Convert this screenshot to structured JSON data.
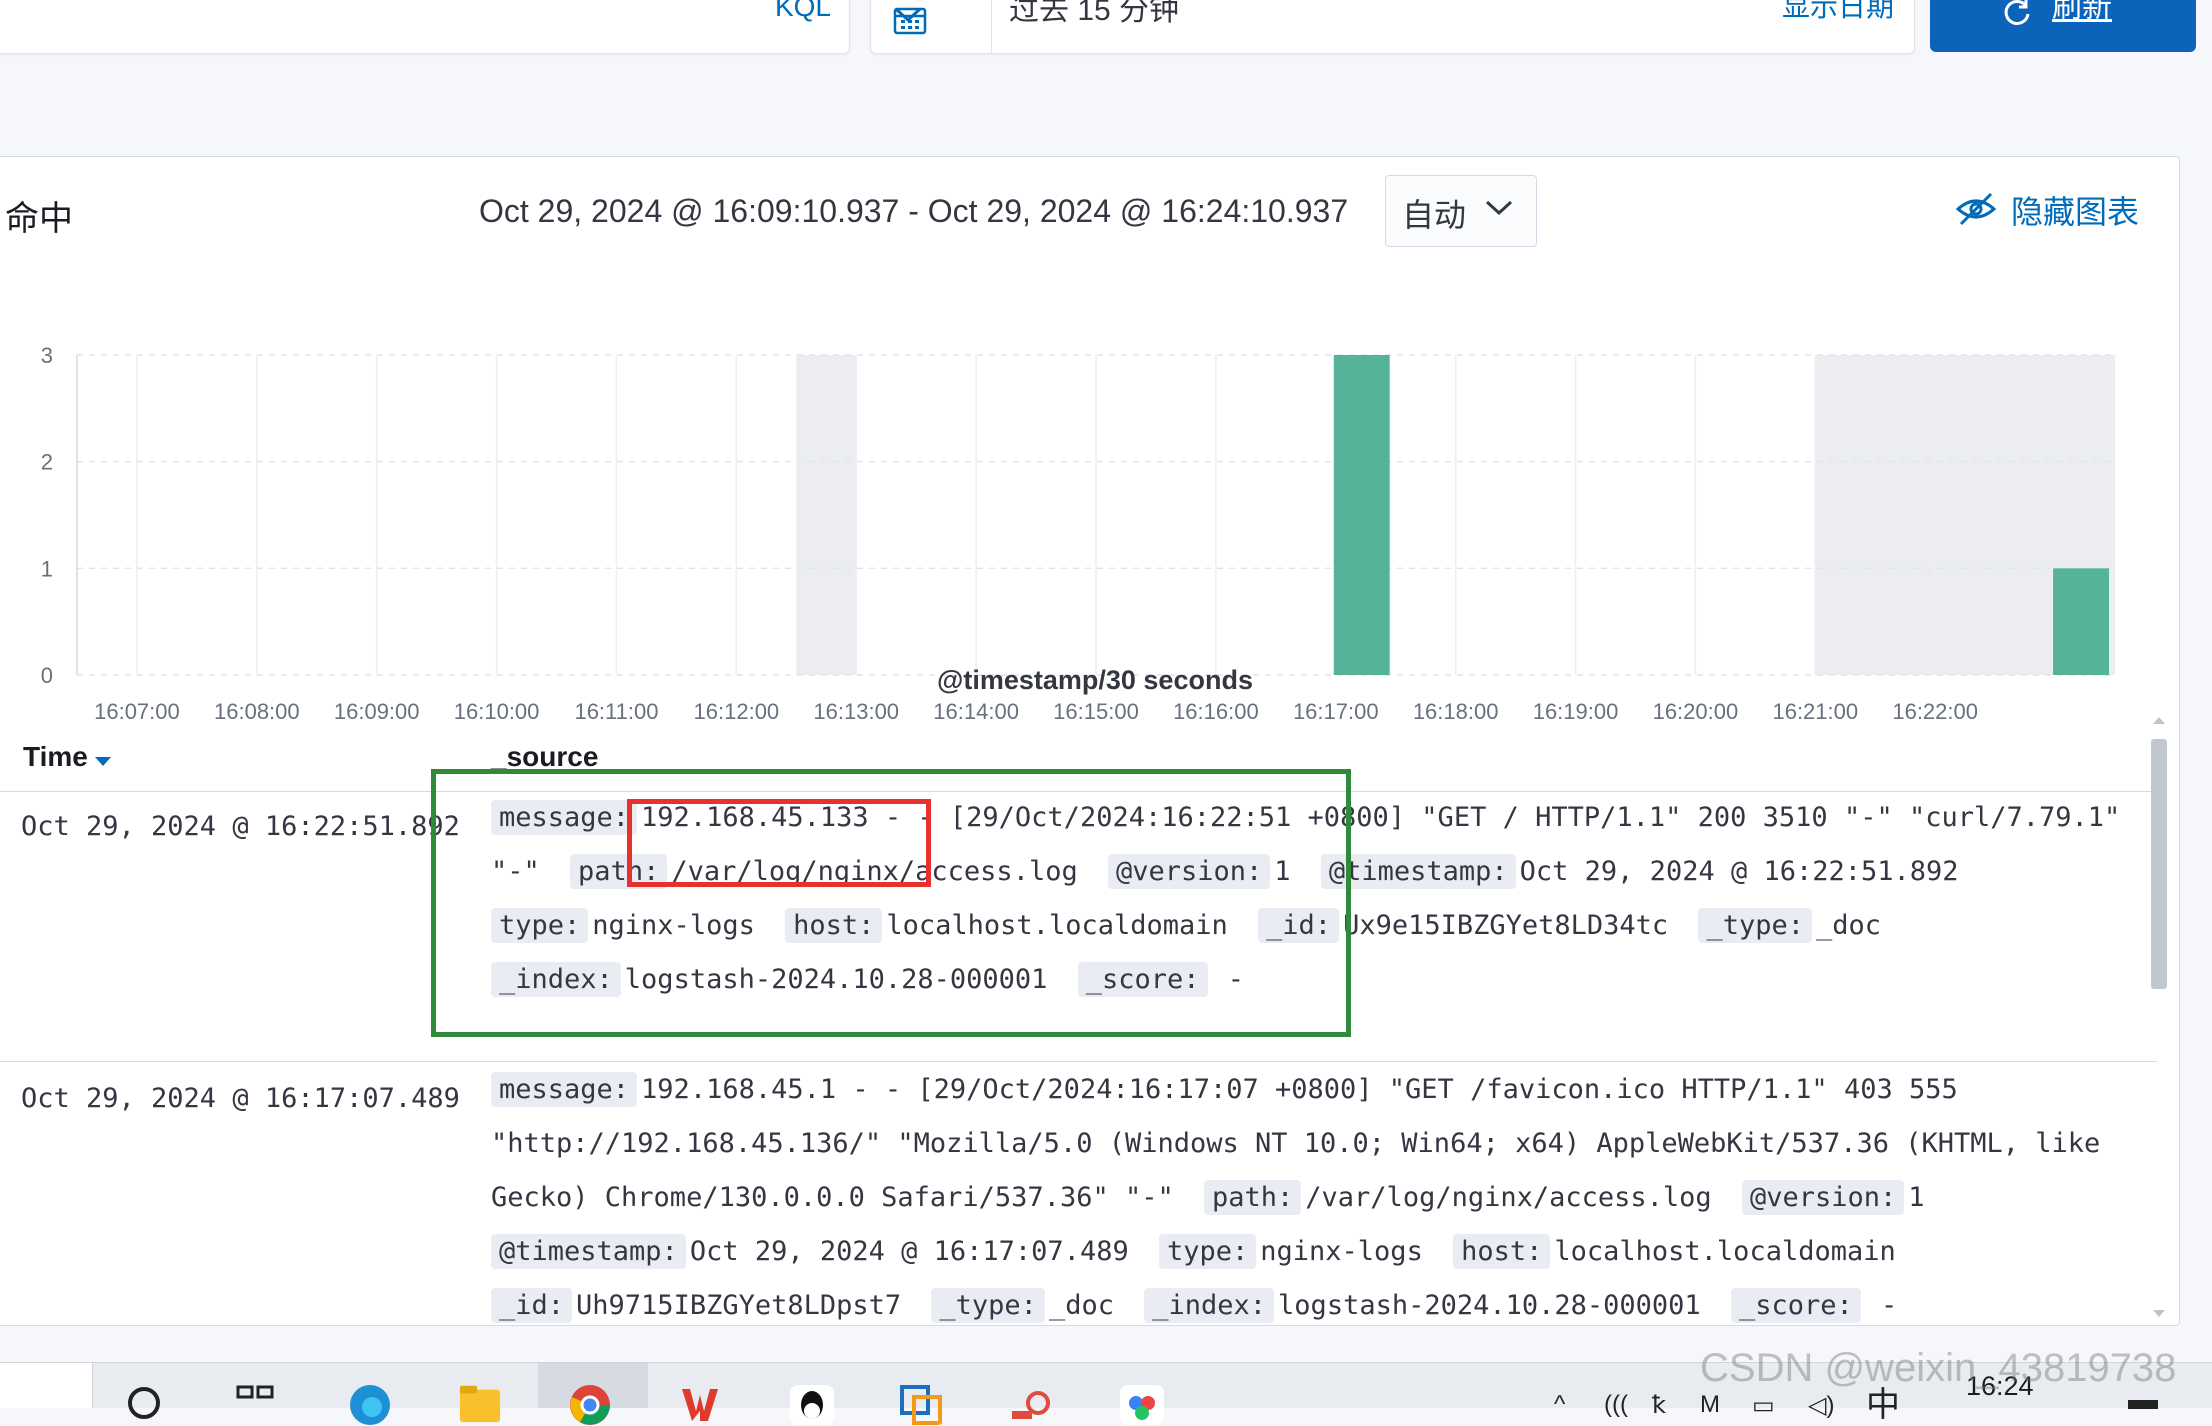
{
  "query_bar": {
    "language_label": "KQL",
    "time_range_label": "过去 15 分钟",
    "show_dates_label": "显示日期",
    "refresh_label": "刷新"
  },
  "chart_header": {
    "hits_label": "命中",
    "time_range": "Oct 29, 2024 @ 16:09:10.937 - Oct 29, 2024 @ 16:24:10.937",
    "interval": "自动",
    "hide_chart_label": "隐藏图表"
  },
  "chart_data": {
    "type": "bar",
    "title": "",
    "xlabel": "@timestamp/30 seconds",
    "ylabel": "",
    "ylim": [
      0,
      3
    ],
    "y_ticks": [
      "0",
      "1",
      "2",
      "3"
    ],
    "x_ticks": [
      "16:07:00",
      "16:08:00",
      "16:09:00",
      "16:10:00",
      "16:11:00",
      "16:12:00",
      "16:13:00",
      "16:14:00",
      "16:15:00",
      "16:16:00",
      "16:17:00",
      "16:18:00",
      "16:19:00",
      "16:20:00",
      "16:21:00",
      "16:22:00"
    ],
    "x_range": [
      "16:06:30",
      "16:23:30"
    ],
    "bars": [
      {
        "x": "16:17:00",
        "value": 3
      },
      {
        "x": "16:23:00",
        "value": 1
      }
    ],
    "bar_color": "#54b399",
    "grid": true,
    "shaded_ranges": [
      [
        "16:12:30",
        "16:13:00"
      ],
      [
        "16:21:00",
        "16:23:30"
      ]
    ]
  },
  "table": {
    "col_time": "Time",
    "col_source": "_source",
    "rows": [
      {
        "time": "Oct 29, 2024 @ 16:22:51.892",
        "fields": [
          {
            "k": "message:",
            "v": "192.168.45.133 - - [29/Oct/2024:16:22:51 +0800] \"GET / HTTP/1.1\" 200 3510 \"-\" \"curl/7.79.1\" \"-\""
          },
          {
            "k": "path:",
            "v": "/var/log/nginx/access.log"
          },
          {
            "k": "@version:",
            "v": "1"
          },
          {
            "k": "@timestamp:",
            "v": "Oct 29, 2024 @ 16:22:51.892"
          },
          {
            "k": "type:",
            "v": "nginx-logs"
          },
          {
            "k": "host:",
            "v": "localhost.localdomain"
          },
          {
            "k": "_id:",
            "v": "Ux9e15IBZGYet8LD34tc"
          },
          {
            "k": "_type:",
            "v": "_doc"
          },
          {
            "k": "_index:",
            "v": "logstash-2024.10.28-000001"
          },
          {
            "k": "_score:",
            "v": " -"
          }
        ]
      },
      {
        "time": "Oct 29, 2024 @ 16:17:07.489",
        "fields": [
          {
            "k": "message:",
            "v": "192.168.45.1 - - [29/Oct/2024:16:17:07 +0800] \"GET /favicon.ico HTTP/1.1\" 403 555 \"http://192.168.45.136/\" \"Mozilla/5.0 (Windows NT 10.0; Win64; x64) AppleWebKit/537.36 (KHTML, like Gecko) Chrome/130.0.0.0 Safari/537.36\" \"-\""
          },
          {
            "k": "path:",
            "v": "/var/log/nginx/access.log"
          },
          {
            "k": "@version:",
            "v": "1"
          },
          {
            "k": "@timestamp:",
            "v": "Oct 29, 2024 @ 16:17:07.489"
          },
          {
            "k": "type:",
            "v": "nginx-logs"
          },
          {
            "k": "host:",
            "v": "localhost.localdomain"
          },
          {
            "k": "_id:",
            "v": "Uh9715IBZGYet8LDpst7"
          },
          {
            "k": "_type:",
            "v": "_doc"
          },
          {
            "k": "_index:",
            "v": "logstash-2024.10.28-000001"
          },
          {
            "k": "_score:",
            "v": " -"
          }
        ]
      }
    ]
  },
  "taskbar": {
    "clock": "16:24",
    "tray_ime": "中"
  },
  "watermark": "CSDN @weixin_43819738"
}
